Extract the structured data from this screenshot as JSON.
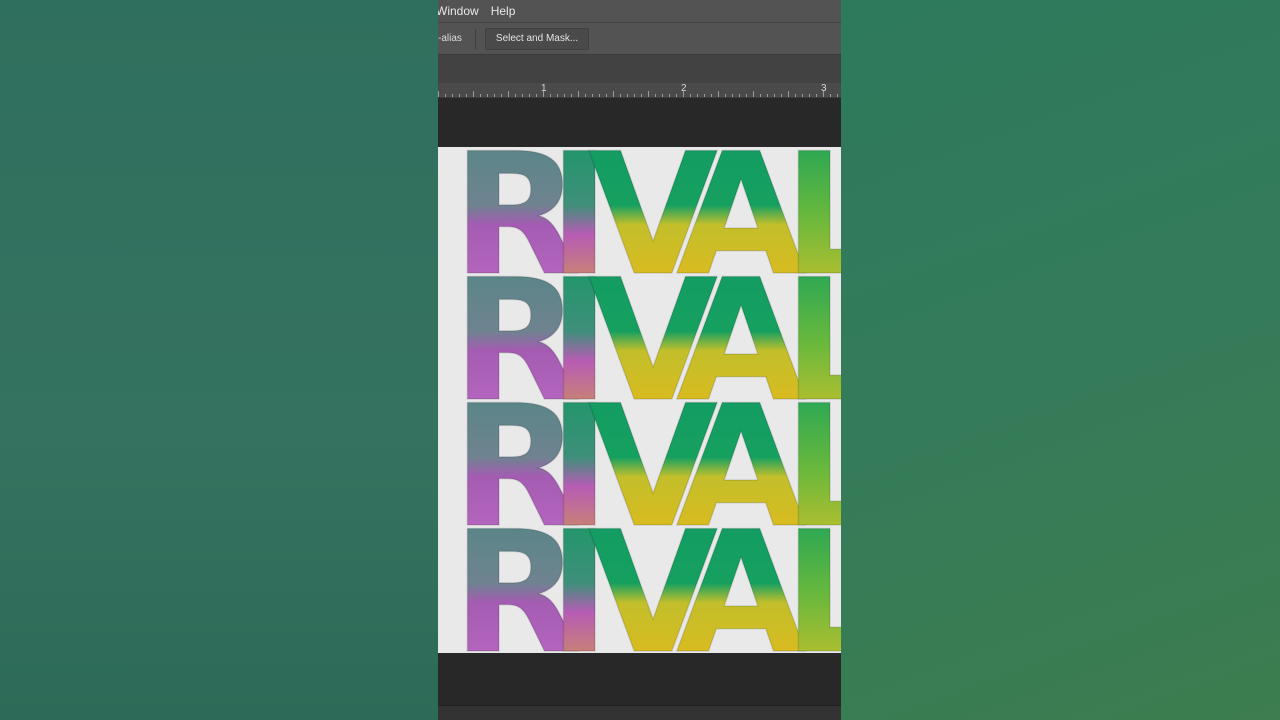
{
  "menubar": {
    "items": [
      "Window",
      "Help"
    ]
  },
  "options_bar": {
    "anti_alias_label": "-alias",
    "select_mask_button": "Select and Mask..."
  },
  "ruler": {
    "numbers": [
      "1",
      "2",
      "3"
    ]
  },
  "canvas": {
    "word": "RIVAL",
    "letters": [
      "R",
      "I",
      "V",
      "A",
      "L"
    ],
    "rows": 4,
    "colors": {
      "teal": "#4f8783",
      "green": "#129a63",
      "magenta": "#b25bbd",
      "yellow": "#e9b91a",
      "lime": "#c5c826",
      "background": "#e9e9e9"
    }
  }
}
